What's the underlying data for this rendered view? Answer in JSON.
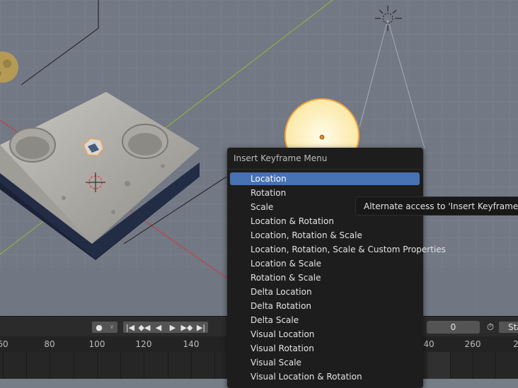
{
  "menu": {
    "title": "Insert Keyframe Menu",
    "items": [
      {
        "label": "Location"
      },
      {
        "label": "Rotation"
      },
      {
        "label": "Scale"
      },
      {
        "label": "Location & Rotation"
      },
      {
        "label": "Location, Rotation & Scale"
      },
      {
        "label": "Location, Rotation, Scale & Custom Properties"
      },
      {
        "label": "Location & Scale"
      },
      {
        "label": "Rotation & Scale"
      },
      {
        "label": "Delta Location"
      },
      {
        "label": "Delta Rotation"
      },
      {
        "label": "Delta Scale"
      },
      {
        "label": "Visual Location"
      },
      {
        "label": "Visual Rotation"
      },
      {
        "label": "Visual Scale"
      },
      {
        "label": "Visual Location & Rotation"
      }
    ],
    "highlighted_index": 0
  },
  "tooltip": {
    "text": "Alternate access to 'Insert Keyframe' for key"
  },
  "timeline": {
    "current_frame": "0",
    "start_label": "Sta",
    "ruler_ticks": [
      "60",
      "80",
      "100",
      "120",
      "140",
      "40",
      "260",
      "2"
    ],
    "playback_icons": [
      "record-dot-icon",
      "chevron-down-icon",
      "jump-start-icon",
      "prev-keyframe-icon",
      "play-reverse-icon",
      "play-icon",
      "next-keyframe-icon",
      "jump-end-icon",
      "stopwatch-icon"
    ]
  },
  "colors": {
    "viewport_bg": "#777d86",
    "highlight": "#4772b3",
    "menu_bg": "#1d1d1d",
    "timeline_bg": "#2b2b2b"
  }
}
